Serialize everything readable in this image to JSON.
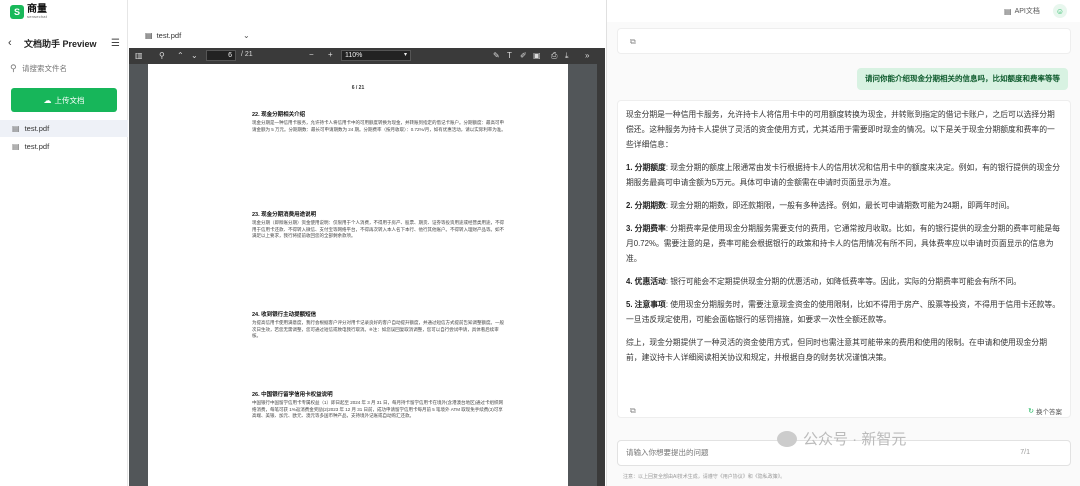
{
  "app": {
    "logo_text": "商量",
    "logo_sub": "sensechat",
    "logo_mark": "S"
  },
  "sidebar": {
    "back_icon": "chevron-left-icon",
    "title": "文档助手 Preview",
    "menu_icon": "menu-collapse-icon",
    "search_placeholder": "请搜索文件名",
    "upload_label": "上传文档",
    "files": [
      {
        "name": "test.pdf",
        "active": true
      },
      {
        "name": "test.pdf",
        "active": false
      }
    ]
  },
  "pdf": {
    "tab_name": "test.pdf",
    "current_page": "6",
    "total_pages": "/ 21",
    "zoom": "110%",
    "page_header": "6 / 21",
    "sections": [
      {
        "title": "22. 现金分期相关介绍",
        "body": "现金分期是一种信用卡服务，允许持卡人将信用卡中的可用额度转换为现金，并转账到指定的借记卡账户。分期额度：最高可申请金额为 5 万元。分期期数：最长可申请期数为 24 期。分期费率（按月收取）：0.72%/月，如有优惠活动，请以实际利率为准。"
      },
      {
        "title": "23. 现金分期消费用途说明",
        "body": "现金分期（即赊账分期）资金使用说明：仅限用于个人消费，不得用于房产、股票、期货、证券等投资用途或经营类用途，不得用于信用卡还款、不得转入微信、支付宝等网络平台，不得再次转入本人名下本行、他行其他账户。不得转入理财产品等。如不满足以上要求，我行将提前收回您的全部剩余款项。"
      },
      {
        "title": "24. 收到银行主动提额短信",
        "body": "为提高信用卡使用满意度，我行会根据客户评分对用卡记录良好的客户自动提升额度，并通过短信方式提前告知调整额度。一般次日生效，若您无需调整，您可通过短信或致电我行取消。※注：如您误回复取消调整，您可以自行尝试申请，具体看后续审核。"
      },
      {
        "title": "26. 中国银行留学信用卡权益说明",
        "body": "中国银行中国留学信用卡专属权益（1）即日起至 2024 年 3 月 31 日，每月持卡留学信用卡在境外(含港澳台地区)通过卡组织网络消费，每笔可获 1%返消费金奖励(2)2023 年 12 月 31 日前，成功申请留学信用卡每月前 5 笔境外 ATM 取现免手续费(3)可享高端、美银、加元、欧元、澳元等多国币种产品，支持境外记账或自动购汇还款。"
      }
    ]
  },
  "chat": {
    "api_doc_label": "API文档",
    "user_question": "请问你能介绍现金分期相关的信息吗，比如额度和费率等等",
    "answer_intro": "现金分期是一种信用卡服务，允许持卡人将信用卡中的可用额度转换为现金，并转账到指定的借记卡账户，之后可以选择分期偿还。这种服务为持卡人提供了灵活的资金使用方式，尤其适用于需要即时现金的情况。以下是关于现金分期额度和费率的一些详细信息：",
    "points": [
      {
        "label": "1. 分期额度",
        "text": ": 现金分期的额度上限通常由发卡行根据持卡人的信用状况和信用卡中的额度来决定。例如，有的银行提供的现金分期服务最高可申请金额为5万元。具体可申请的金额需在申请时页面显示为准。"
      },
      {
        "label": "2. 分期期数",
        "text": ": 现金分期的期数，即还款期限，一般有多种选择。例如，最长可申请期数可能为24期，即两年时间。"
      },
      {
        "label": "3. 分期费率",
        "text": ": 分期费率是使用现金分期服务需要支付的费用，它通常按月收取。比如，有的银行提供的现金分期的费率可能是每月0.72%。需要注意的是，费率可能会根据银行的政策和持卡人的信用情况有所不同，具体费率应以申请时页面显示的信息为准。"
      },
      {
        "label": "4. 优惠活动",
        "text": ": 银行可能会不定期提供现金分期的优惠活动，如降低费率等。因此，实际的分期费率可能会有所不同。"
      },
      {
        "label": "5. 注意事项",
        "text": ": 使用现金分期服务时，需要注意现金资金的使用限制，比如不得用于房产、股票等投资，不得用于信用卡还款等。一旦违反规定使用，可能会面临银行的惩罚措施，如要求一次性全额还款等。"
      }
    ],
    "answer_outro": "综上，现金分期提供了一种灵活的资金使用方式，但同时也需注意其可能带来的费用和使用的限制。在申请和使用现金分期前，建议持卡人详细阅读相关协议和规定，并根据自身的财务状况谨慎决策。",
    "regen_label": "换个答案",
    "input_placeholder": "请输入你想要提出的问题",
    "input_count": "7/1",
    "watermark": "公众号 · 新智元",
    "disclaimer": "注意：以上回复全部由AI技术生成，请遵守《用户协议》和《隐私政策》。"
  }
}
